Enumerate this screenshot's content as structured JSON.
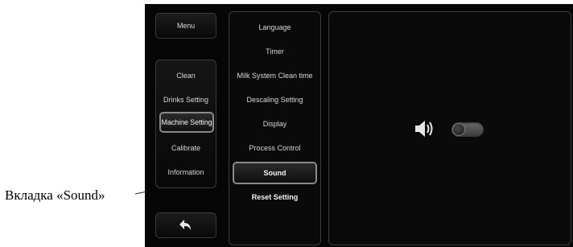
{
  "annotation": {
    "callout_label": "Вкладка «Sound»"
  },
  "left_panel": {
    "menu_button_label": "Menu",
    "items": [
      {
        "label": "Clean"
      },
      {
        "label": "Drinks Setting"
      },
      {
        "label": "Machine Setting",
        "active": true
      },
      {
        "label": "Calibrate"
      },
      {
        "label": "Information"
      }
    ],
    "back_icon": "back-arrow-icon"
  },
  "middle_panel": {
    "items": [
      {
        "label": "Language"
      },
      {
        "label": "Timer"
      },
      {
        "label": "Milk System Clean time"
      },
      {
        "label": "Descaling Setting"
      },
      {
        "label": "Display"
      },
      {
        "label": "Process Control"
      },
      {
        "label": "Sound",
        "selected": true
      },
      {
        "label": "Reset Setting"
      }
    ]
  },
  "right_panel": {
    "speaker_icon": "speaker-icon",
    "sound_toggle_on": false
  },
  "colors": {
    "screen_background": "#060606",
    "active_border": "#8a8a8a",
    "text": "#d8d8d8"
  }
}
